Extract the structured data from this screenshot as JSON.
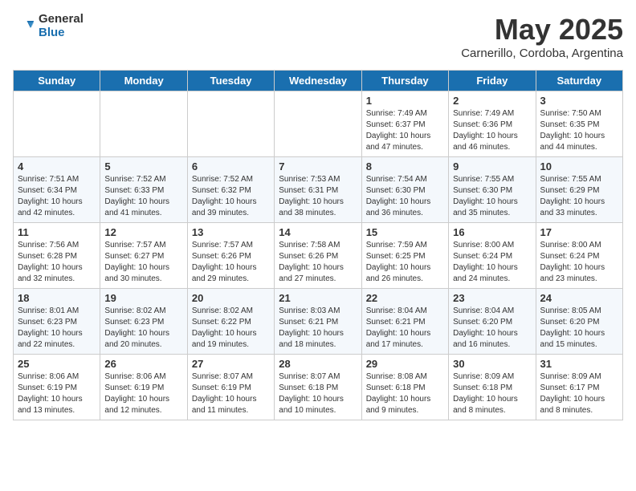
{
  "logo": {
    "general": "General",
    "blue": "Blue"
  },
  "title": "May 2025",
  "subtitle": "Carnerillo, Cordoba, Argentina",
  "weekdays": [
    "Sunday",
    "Monday",
    "Tuesday",
    "Wednesday",
    "Thursday",
    "Friday",
    "Saturday"
  ],
  "weeks": [
    [
      {
        "date": "",
        "sunrise": "",
        "sunset": "",
        "daylight": ""
      },
      {
        "date": "",
        "sunrise": "",
        "sunset": "",
        "daylight": ""
      },
      {
        "date": "",
        "sunrise": "",
        "sunset": "",
        "daylight": ""
      },
      {
        "date": "",
        "sunrise": "",
        "sunset": "",
        "daylight": ""
      },
      {
        "date": "1",
        "sunrise": "Sunrise: 7:49 AM",
        "sunset": "Sunset: 6:37 PM",
        "daylight": "Daylight: 10 hours and 47 minutes."
      },
      {
        "date": "2",
        "sunrise": "Sunrise: 7:49 AM",
        "sunset": "Sunset: 6:36 PM",
        "daylight": "Daylight: 10 hours and 46 minutes."
      },
      {
        "date": "3",
        "sunrise": "Sunrise: 7:50 AM",
        "sunset": "Sunset: 6:35 PM",
        "daylight": "Daylight: 10 hours and 44 minutes."
      }
    ],
    [
      {
        "date": "4",
        "sunrise": "Sunrise: 7:51 AM",
        "sunset": "Sunset: 6:34 PM",
        "daylight": "Daylight: 10 hours and 42 minutes."
      },
      {
        "date": "5",
        "sunrise": "Sunrise: 7:52 AM",
        "sunset": "Sunset: 6:33 PM",
        "daylight": "Daylight: 10 hours and 41 minutes."
      },
      {
        "date": "6",
        "sunrise": "Sunrise: 7:52 AM",
        "sunset": "Sunset: 6:32 PM",
        "daylight": "Daylight: 10 hours and 39 minutes."
      },
      {
        "date": "7",
        "sunrise": "Sunrise: 7:53 AM",
        "sunset": "Sunset: 6:31 PM",
        "daylight": "Daylight: 10 hours and 38 minutes."
      },
      {
        "date": "8",
        "sunrise": "Sunrise: 7:54 AM",
        "sunset": "Sunset: 6:30 PM",
        "daylight": "Daylight: 10 hours and 36 minutes."
      },
      {
        "date": "9",
        "sunrise": "Sunrise: 7:55 AM",
        "sunset": "Sunset: 6:30 PM",
        "daylight": "Daylight: 10 hours and 35 minutes."
      },
      {
        "date": "10",
        "sunrise": "Sunrise: 7:55 AM",
        "sunset": "Sunset: 6:29 PM",
        "daylight": "Daylight: 10 hours and 33 minutes."
      }
    ],
    [
      {
        "date": "11",
        "sunrise": "Sunrise: 7:56 AM",
        "sunset": "Sunset: 6:28 PM",
        "daylight": "Daylight: 10 hours and 32 minutes."
      },
      {
        "date": "12",
        "sunrise": "Sunrise: 7:57 AM",
        "sunset": "Sunset: 6:27 PM",
        "daylight": "Daylight: 10 hours and 30 minutes."
      },
      {
        "date": "13",
        "sunrise": "Sunrise: 7:57 AM",
        "sunset": "Sunset: 6:26 PM",
        "daylight": "Daylight: 10 hours and 29 minutes."
      },
      {
        "date": "14",
        "sunrise": "Sunrise: 7:58 AM",
        "sunset": "Sunset: 6:26 PM",
        "daylight": "Daylight: 10 hours and 27 minutes."
      },
      {
        "date": "15",
        "sunrise": "Sunrise: 7:59 AM",
        "sunset": "Sunset: 6:25 PM",
        "daylight": "Daylight: 10 hours and 26 minutes."
      },
      {
        "date": "16",
        "sunrise": "Sunrise: 8:00 AM",
        "sunset": "Sunset: 6:24 PM",
        "daylight": "Daylight: 10 hours and 24 minutes."
      },
      {
        "date": "17",
        "sunrise": "Sunrise: 8:00 AM",
        "sunset": "Sunset: 6:24 PM",
        "daylight": "Daylight: 10 hours and 23 minutes."
      }
    ],
    [
      {
        "date": "18",
        "sunrise": "Sunrise: 8:01 AM",
        "sunset": "Sunset: 6:23 PM",
        "daylight": "Daylight: 10 hours and 22 minutes."
      },
      {
        "date": "19",
        "sunrise": "Sunrise: 8:02 AM",
        "sunset": "Sunset: 6:23 PM",
        "daylight": "Daylight: 10 hours and 20 minutes."
      },
      {
        "date": "20",
        "sunrise": "Sunrise: 8:02 AM",
        "sunset": "Sunset: 6:22 PM",
        "daylight": "Daylight: 10 hours and 19 minutes."
      },
      {
        "date": "21",
        "sunrise": "Sunrise: 8:03 AM",
        "sunset": "Sunset: 6:21 PM",
        "daylight": "Daylight: 10 hours and 18 minutes."
      },
      {
        "date": "22",
        "sunrise": "Sunrise: 8:04 AM",
        "sunset": "Sunset: 6:21 PM",
        "daylight": "Daylight: 10 hours and 17 minutes."
      },
      {
        "date": "23",
        "sunrise": "Sunrise: 8:04 AM",
        "sunset": "Sunset: 6:20 PM",
        "daylight": "Daylight: 10 hours and 16 minutes."
      },
      {
        "date": "24",
        "sunrise": "Sunrise: 8:05 AM",
        "sunset": "Sunset: 6:20 PM",
        "daylight": "Daylight: 10 hours and 15 minutes."
      }
    ],
    [
      {
        "date": "25",
        "sunrise": "Sunrise: 8:06 AM",
        "sunset": "Sunset: 6:19 PM",
        "daylight": "Daylight: 10 hours and 13 minutes."
      },
      {
        "date": "26",
        "sunrise": "Sunrise: 8:06 AM",
        "sunset": "Sunset: 6:19 PM",
        "daylight": "Daylight: 10 hours and 12 minutes."
      },
      {
        "date": "27",
        "sunrise": "Sunrise: 8:07 AM",
        "sunset": "Sunset: 6:19 PM",
        "daylight": "Daylight: 10 hours and 11 minutes."
      },
      {
        "date": "28",
        "sunrise": "Sunrise: 8:07 AM",
        "sunset": "Sunset: 6:18 PM",
        "daylight": "Daylight: 10 hours and 10 minutes."
      },
      {
        "date": "29",
        "sunrise": "Sunrise: 8:08 AM",
        "sunset": "Sunset: 6:18 PM",
        "daylight": "Daylight: 10 hours and 9 minutes."
      },
      {
        "date": "30",
        "sunrise": "Sunrise: 8:09 AM",
        "sunset": "Sunset: 6:18 PM",
        "daylight": "Daylight: 10 hours and 8 minutes."
      },
      {
        "date": "31",
        "sunrise": "Sunrise: 8:09 AM",
        "sunset": "Sunset: 6:17 PM",
        "daylight": "Daylight: 10 hours and 8 minutes."
      }
    ]
  ]
}
